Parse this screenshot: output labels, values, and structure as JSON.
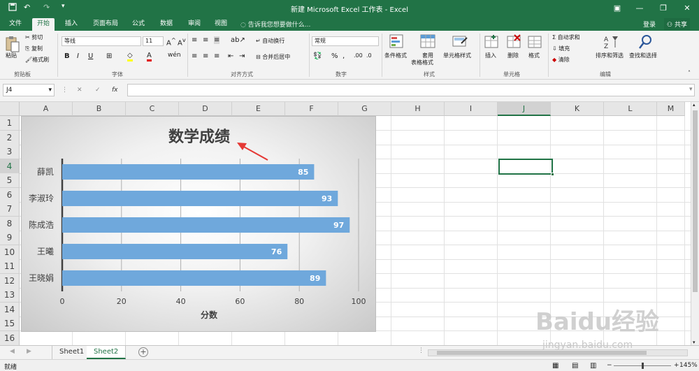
{
  "titlebar": {
    "title": "新建 Microsoft Excel 工作表 - Excel",
    "save_icon": "save-icon",
    "undo_icon": "undo-icon",
    "redo_icon": "redo-icon",
    "customize_icon": "customize-qa-icon"
  },
  "tabs": [
    {
      "label": "文件"
    },
    {
      "label": "开始"
    },
    {
      "label": "插入"
    },
    {
      "label": "页面布局"
    },
    {
      "label": "公式"
    },
    {
      "label": "数据"
    },
    {
      "label": "审阅"
    },
    {
      "label": "视图"
    }
  ],
  "tell_me": "告诉我您想要做什么...",
  "login": "登录",
  "share": "共享",
  "ribbon": {
    "clipboard": {
      "paste": "粘贴",
      "cut": "剪切",
      "copy": "复制",
      "format_painter": "格式刷",
      "group": "剪贴板"
    },
    "font": {
      "name": "等线",
      "size": "11",
      "bold": "B",
      "italic": "I",
      "underline": "U",
      "group": "字体"
    },
    "alignment": {
      "wrap": "自动换行",
      "merge": "合并后居中",
      "group": "对齐方式"
    },
    "number": {
      "format": "常规",
      "group": "数字"
    },
    "styles": {
      "conditional": "条件格式",
      "table_line1": "套用",
      "table_line2": "表格格式",
      "cell_styles": "单元格样式",
      "group": "样式"
    },
    "cells": {
      "insert": "插入",
      "delete": "删除",
      "format": "格式",
      "group": "单元格"
    },
    "editing": {
      "autosum": "自动求和",
      "fill": "填充",
      "clear": "清除",
      "sort": "排序和筛选",
      "find": "查找和选择",
      "group": "编辑"
    }
  },
  "formula_bar": {
    "name_box": "J4",
    "formula": ""
  },
  "columns": [
    "A",
    "B",
    "C",
    "D",
    "E",
    "F",
    "G",
    "H",
    "I",
    "J",
    "K",
    "L",
    "M"
  ],
  "rows": [
    "1",
    "2",
    "3",
    "4",
    "5",
    "6",
    "7",
    "8",
    "9",
    "10",
    "11",
    "12",
    "13",
    "14",
    "15",
    "16"
  ],
  "selected_column": "J",
  "selected_row": "4",
  "chart_data": {
    "type": "bar",
    "title": "数学成绩",
    "xlabel": "分数",
    "ylabel": "",
    "categories": [
      "薛凯",
      "李淑玲",
      "陈成浩",
      "王曦",
      "王晓娟"
    ],
    "values": [
      85,
      93,
      97,
      76,
      89
    ],
    "xlim": [
      0,
      100
    ],
    "xticks": [
      0,
      20,
      40,
      60,
      80,
      100
    ],
    "bar_color": "#6fa8dc",
    "grid": "vertical",
    "legend": "none",
    "data_labels": true
  },
  "sheets": [
    {
      "name": "Sheet1"
    },
    {
      "name": "Sheet2"
    }
  ],
  "active_sheet": "Sheet2",
  "status": {
    "ready": "就绪",
    "zoom": "145%"
  },
  "watermark": {
    "text": "Baidu经验",
    "url": "jingyan.baidu.com"
  },
  "colors": {
    "accent": "#217346",
    "bar": "#6fa8dc"
  }
}
